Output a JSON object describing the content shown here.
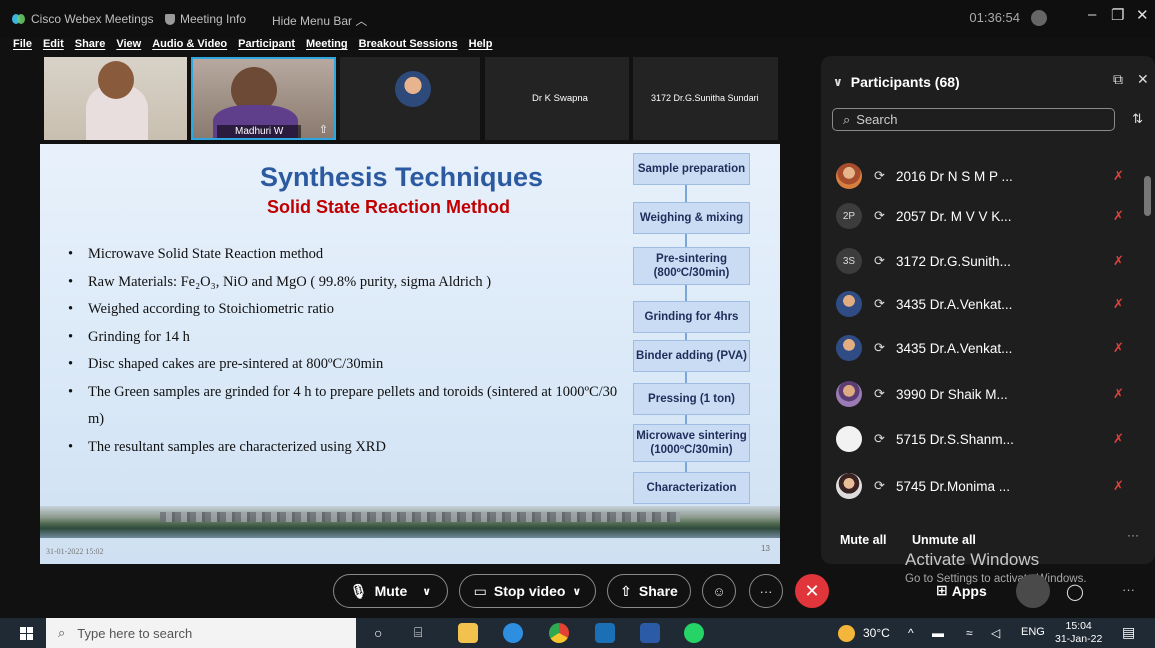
{
  "titlebar": {
    "app_name": "Cisco Webex Meetings",
    "meeting_info": "Meeting Info",
    "hide_menu": "Hide Menu Bar ︿",
    "clock": "01:36:54",
    "minimize": "–",
    "restore": "❐",
    "close": "✕"
  },
  "menu": [
    "File",
    "Edit",
    "Share",
    "View",
    "Audio & Video",
    "Participant",
    "Meeting",
    "Breakout Sessions",
    "Help"
  ],
  "videos": {
    "v2_name": "Madhuri W",
    "v4_name": "Dr K Swapna",
    "v5_name": "3172 Dr.G.Sunitha Sundari"
  },
  "slide": {
    "title": "Synthesis Techniques",
    "subtitle": "Solid State Reaction Method",
    "bullets": [
      "Microwave Solid State Reaction method",
      "Raw Materials: Fe₂O₃, NiO and MgO ( 99.8% purity, sigma Aldrich )",
      "Weighed  according to Stoichiometric ratio",
      "Grinding for 14 h",
      "Disc shaped cakes are pre-sintered at 800ºC/30min",
      "The Green  samples are grinded for 4 h to prepare pellets and toroids (sintered  at 1000ºC/30 m)",
      "The resultant samples are characterized using XRD"
    ],
    "flow": [
      "Sample preparation",
      "Weighing & mixing",
      "Pre-sintering (800ºC/30min)",
      "Grinding for 4hrs",
      "Binder adding (PVA)",
      "Pressing (1 ton)",
      "Microwave sintering (1000ºC/30min)",
      "Characterization"
    ],
    "date": "31-01-2022 15:02",
    "page": "13"
  },
  "participants": {
    "title": "Participants (68)",
    "search_placeholder": "Search",
    "items": [
      {
        "name": "2016 Dr N S M P ...",
        "avatar": "photo1",
        "initials": ""
      },
      {
        "name": "2057 Dr. M V V K...",
        "avatar": "init",
        "initials": "2P"
      },
      {
        "name": "3172 Dr.G.Sunith...",
        "avatar": "init",
        "initials": "3S"
      },
      {
        "name": "3435 Dr.A.Venkat...",
        "avatar": "photo2",
        "initials": ""
      },
      {
        "name": "3435 Dr.A.Venkat...",
        "avatar": "photo2",
        "initials": ""
      },
      {
        "name": "3990 Dr Shaik M...",
        "avatar": "photo3",
        "initials": ""
      },
      {
        "name": "5715 Dr.S.Shanm...",
        "avatar": "blank",
        "initials": ""
      },
      {
        "name": "5745 Dr.Monima ...",
        "avatar": "photo4",
        "initials": ""
      }
    ],
    "mute_all": "Mute all",
    "unmute_all": "Unmute all"
  },
  "watermark": {
    "line1": "Activate Windows",
    "line2": "Go to Settings to activate Windows."
  },
  "controls": {
    "mute": "Mute",
    "stop_video": "Stop video",
    "share": "Share",
    "apps": "Apps"
  },
  "taskbar": {
    "search_placeholder": "Type here to search",
    "weather": "30°C",
    "lang": "ENG",
    "time": "15:04",
    "date": "31-Jan-22"
  }
}
